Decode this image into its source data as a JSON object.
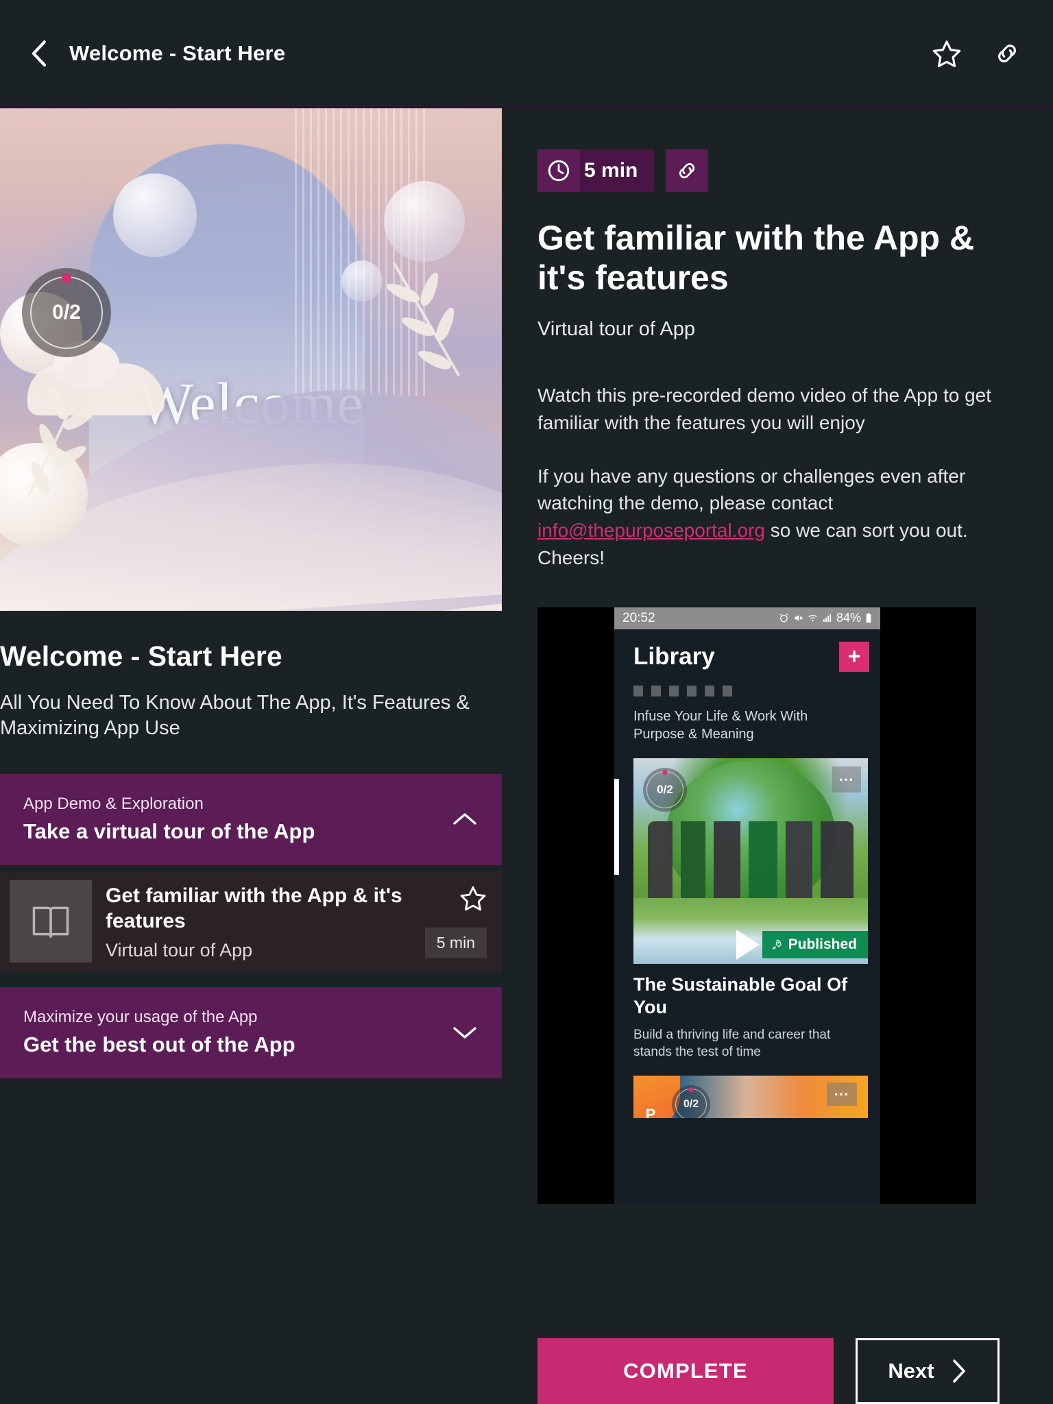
{
  "header": {
    "title": "Welcome - Start Here",
    "back_icon": "chevron-left-icon",
    "favorite_icon": "star-icon",
    "share_icon": "link-icon"
  },
  "hero": {
    "word": "Welcome",
    "progress": "0/2"
  },
  "course": {
    "title": "Welcome - Start Here",
    "subtitle": "All You Need To Know About The App, It's Features & Maximizing App Use"
  },
  "accordion": [
    {
      "eyebrow": "App Demo & Exploration",
      "heading": "Take a virtual tour of the App",
      "chevron": "chevron-up-icon",
      "expanded": true
    },
    {
      "eyebrow": "Maximize your usage of the App",
      "heading": "Get the best out of the App",
      "chevron": "chevron-down-icon",
      "expanded": false
    }
  ],
  "lesson_item": {
    "thumb_icon": "book-icon",
    "title": "Get familiar with the App & it's features",
    "subtitle": "Virtual tour of App",
    "favorite_icon": "star-icon",
    "duration": "5 min"
  },
  "detail": {
    "duration_badge": "5 min",
    "clock_icon": "clock-icon",
    "link_icon": "link-icon",
    "heading": "Get familiar with the App & it's features",
    "subheading": "Virtual tour of App",
    "paragraph_1": "Watch this pre-recorded demo video of the App to get familiar with the features you will enjoy",
    "paragraph_2_before": "If you have any questions or challenges even after watching the demo, please contact ",
    "email_link": "info@thepurposeportal.org",
    "paragraph_2_after": " so we can sort you out. Cheers!"
  },
  "phone_preview": {
    "status_time": "20:52",
    "status_battery": "84%",
    "app_title": "Library",
    "add_label": "+",
    "tagline": "Infuse Your Life & Work With Purpose & Meaning",
    "card": {
      "progress": "0/2",
      "menu_icon": "more-horizontal-icon",
      "status_badge": "Published",
      "rocket_icon": "rocket-icon",
      "play_icon": "play-icon",
      "title": "The Sustainable Goal Of You",
      "subtitle": "Build a thriving life and career that stands the test of time"
    },
    "card2": {
      "progress": "0/2",
      "menu_icon": "more-horizontal-icon",
      "logo": "P"
    }
  },
  "footer": {
    "complete_label": "COMPLETE",
    "next_label": "Next",
    "next_icon": "chevron-right-icon"
  },
  "colors": {
    "background": "#1a2224",
    "purple": "#5c1c56",
    "pink": "#c82a71",
    "link_pink": "#d62a74",
    "green": "#0f8c55"
  }
}
